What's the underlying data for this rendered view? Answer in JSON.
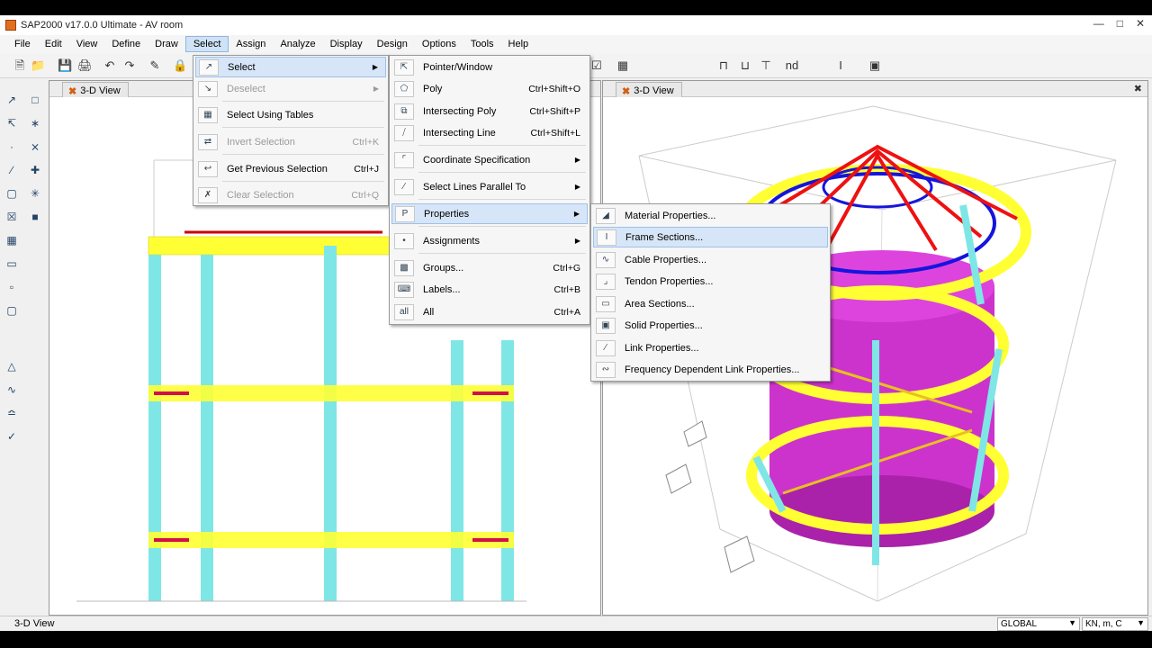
{
  "window": {
    "title": "SAP2000 v17.0.0 Ultimate  - AV room"
  },
  "menubar": [
    "File",
    "Edit",
    "View",
    "Define",
    "Draw",
    "Select",
    "Assign",
    "Analyze",
    "Display",
    "Design",
    "Options",
    "Tools",
    "Help"
  ],
  "panels": {
    "left_tab": "3-D View",
    "right_tab": "3-D View"
  },
  "status": {
    "left": "3-D View",
    "coord": "GLOBAL",
    "units": "KN, m, C"
  },
  "select_menu": [
    {
      "label": "Select",
      "shortcut": "",
      "submenu": true,
      "highlight": true,
      "disabled": false,
      "icon": "pointer-icon"
    },
    {
      "label": "Deselect",
      "shortcut": "",
      "submenu": true,
      "highlight": false,
      "disabled": true,
      "icon": "deselect-icon"
    },
    {
      "label": "Select Using Tables",
      "shortcut": "",
      "submenu": false,
      "highlight": false,
      "disabled": false,
      "icon": "table-icon"
    },
    {
      "label": "Invert Selection",
      "shortcut": "Ctrl+K",
      "submenu": false,
      "highlight": false,
      "disabled": true,
      "icon": "invert-icon"
    },
    {
      "label": "Get Previous Selection",
      "shortcut": "Ctrl+J",
      "submenu": false,
      "highlight": false,
      "disabled": false,
      "icon": "previous-selection-icon"
    },
    {
      "label": "Clear Selection",
      "shortcut": "Ctrl+Q",
      "submenu": false,
      "highlight": false,
      "disabled": true,
      "icon": "clear-selection-icon"
    }
  ],
  "select_submenu": [
    {
      "label": "Pointer/Window",
      "shortcut": "",
      "submenu": false,
      "icon": "pointer-window-icon"
    },
    {
      "label": "Poly",
      "shortcut": "Ctrl+Shift+O",
      "submenu": false,
      "icon": "poly-icon"
    },
    {
      "label": "Intersecting Poly",
      "shortcut": "Ctrl+Shift+P",
      "submenu": false,
      "icon": "intersecting-poly-icon"
    },
    {
      "label": "Intersecting Line",
      "shortcut": "Ctrl+Shift+L",
      "submenu": false,
      "icon": "intersecting-line-icon"
    },
    {
      "label": "Coordinate Specification",
      "shortcut": "",
      "submenu": true,
      "icon": "coordinate-icon"
    },
    {
      "label": "Select Lines Parallel To",
      "shortcut": "",
      "submenu": true,
      "icon": "parallel-lines-icon"
    },
    {
      "label": "Properties",
      "shortcut": "",
      "submenu": true,
      "highlight": true,
      "icon": "properties-icon"
    },
    {
      "label": "Assignments",
      "shortcut": "",
      "submenu": true,
      "icon": "assignments-icon"
    },
    {
      "label": "Groups...",
      "shortcut": "Ctrl+G",
      "submenu": false,
      "icon": "groups-icon"
    },
    {
      "label": "Labels...",
      "shortcut": "Ctrl+B",
      "submenu": false,
      "icon": "labels-icon"
    },
    {
      "label": "All",
      "shortcut": "Ctrl+A",
      "submenu": false,
      "icon": "all-icon"
    }
  ],
  "properties_submenu": [
    {
      "label": "Material Properties...",
      "icon": "material-icon"
    },
    {
      "label": "Frame Sections...",
      "icon": "frame-section-icon",
      "highlight": true
    },
    {
      "label": "Cable Properties...",
      "icon": "cable-icon"
    },
    {
      "label": "Tendon Properties...",
      "icon": "tendon-icon"
    },
    {
      "label": "Area Sections...",
      "icon": "area-section-icon"
    },
    {
      "label": "Solid Properties...",
      "icon": "solid-icon"
    },
    {
      "label": "Link Properties...",
      "icon": "link-icon"
    },
    {
      "label": "Frequency Dependent Link Properties...",
      "icon": "freq-link-icon"
    }
  ]
}
